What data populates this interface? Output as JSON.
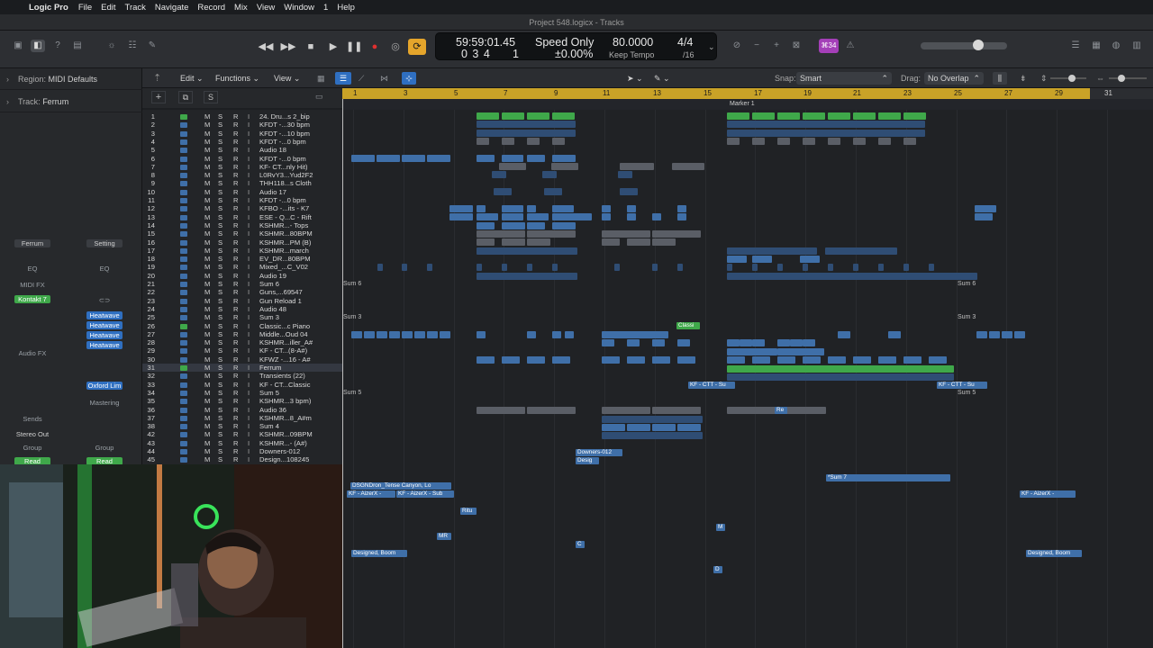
{
  "menubar": {
    "app_name": "Logic Pro",
    "items": [
      "File",
      "Edit",
      "Track",
      "Navigate",
      "Record",
      "Mix",
      "View",
      "Window",
      "1",
      "Help"
    ]
  },
  "window": {
    "title": "Project 548.logicx - Tracks"
  },
  "lcd": {
    "time": "59:59:01.45",
    "bars": "0  3  4",
    "bars_sub": "1",
    "mode": "Speed Only",
    "mode_val": "±0.00%",
    "tempo": "80.0000",
    "tempo_label": "Keep Tempo",
    "sig": "4/4",
    "div": "/16"
  },
  "toolbar": {
    "badge": "⌘34"
  },
  "inspector": {
    "region_label": "Region:",
    "region_value": "MIDI Defaults",
    "track_label": "Track:",
    "track_value": "Ferrum",
    "strip1": {
      "name": "Ferrum",
      "eq": "EQ",
      "midifx": "MIDI FX",
      "instrument": "Kontakt 7",
      "audiofx": "Audio FX",
      "sends": "Sends",
      "output": "Stereo Out",
      "group": "Group",
      "auto": "Read"
    },
    "strip2": {
      "name": "Setting",
      "eq": "EQ",
      "fx": [
        "Heatwave",
        "Heatwave",
        "Heatwave",
        "Heatwave"
      ],
      "oxford": "Oxford Lim",
      "mastering": "Mastering",
      "group": "Group",
      "auto": "Read"
    }
  },
  "editbar": {
    "edit": "Edit",
    "functions": "Functions",
    "view": "View",
    "snap_label": "Snap:",
    "snap_value": "Smart",
    "drag_label": "Drag:",
    "drag_value": "No Overlap"
  },
  "ruler": {
    "ticks": [
      "1",
      "3",
      "5",
      "7",
      "9",
      "11",
      "13",
      "15",
      "17",
      "19",
      "21",
      "23",
      "25",
      "27",
      "29",
      "31"
    ],
    "marker": "Marker 1"
  },
  "tracks": [
    {
      "n": "1",
      "name": "24. Dru...s 2_bip",
      "color": "#3fa84a"
    },
    {
      "n": "2",
      "name": "KFDT -...30 bpm",
      "color": "#3f6fa8"
    },
    {
      "n": "3",
      "name": "KFDT -...10 bpm",
      "color": "#3f6fa8"
    },
    {
      "n": "4",
      "name": "KFDT -...0 bpm",
      "color": "#3f6fa8"
    },
    {
      "n": "5",
      "name": "Audio 18",
      "color": "#3f6fa8"
    },
    {
      "n": "6",
      "name": "KFDT -...0 bpm",
      "color": "#3f6fa8"
    },
    {
      "n": "7",
      "name": "KF- CT...nly Hit)",
      "color": "#3f6fa8"
    },
    {
      "n": "8",
      "name": "L0RvY3...Yud2F2",
      "color": "#3f6fa8"
    },
    {
      "n": "9",
      "name": "THH118...s Cloth",
      "color": "#3f6fa8"
    },
    {
      "n": "10",
      "name": "Audio 17",
      "color": "#3f6fa8"
    },
    {
      "n": "11",
      "name": "KFDT -...0 bpm",
      "color": "#3f6fa8"
    },
    {
      "n": "12",
      "name": "KFBO -...its - K7",
      "color": "#3f6fa8"
    },
    {
      "n": "13",
      "name": "ESE - Q...C - Rift",
      "color": "#3f6fa8"
    },
    {
      "n": "14",
      "name": "KSHMR...- Tops",
      "color": "#3f6fa8"
    },
    {
      "n": "15",
      "name": "KSHMR...80BPM",
      "color": "#3f6fa8"
    },
    {
      "n": "16",
      "name": "KSHMR...PM (B)",
      "color": "#3f6fa8"
    },
    {
      "n": "17",
      "name": "KSHMR...march",
      "color": "#3f6fa8"
    },
    {
      "n": "18",
      "name": "EV_DR...80BPM",
      "color": "#3f6fa8"
    },
    {
      "n": "19",
      "name": "Mixed_...C_V02",
      "color": "#3f6fa8"
    },
    {
      "n": "20",
      "name": "Audio 19",
      "color": "#3f6fa8"
    },
    {
      "n": "21",
      "name": "Sum 6",
      "color": "#3f6fa8"
    },
    {
      "n": "22",
      "name": "Guns,...69547",
      "color": "#3f6fa8"
    },
    {
      "n": "23",
      "name": "Gun Reload 1",
      "color": "#3f6fa8"
    },
    {
      "n": "24",
      "name": "Audio 48",
      "color": "#3f6fa8"
    },
    {
      "n": "25",
      "name": "Sum 3",
      "color": "#3f6fa8"
    },
    {
      "n": "26",
      "name": "Classic...c Piano",
      "color": "#3fa84a"
    },
    {
      "n": "27",
      "name": "Middle...Oud 04",
      "color": "#3f6fa8"
    },
    {
      "n": "28",
      "name": "KSHMR...iller_A#",
      "color": "#3f6fa8"
    },
    {
      "n": "29",
      "name": "KF - CT...(8-A#)",
      "color": "#3f6fa8"
    },
    {
      "n": "30",
      "name": "KFWZ -...16 - A#",
      "color": "#3f6fa8"
    },
    {
      "n": "31",
      "name": "Ferrum",
      "color": "#3fa84a"
    },
    {
      "n": "32",
      "name": "Transients (22)",
      "color": "#3f6fa8"
    },
    {
      "n": "33",
      "name": "KF - CT...Classic",
      "color": "#3f6fa8"
    },
    {
      "n": "34",
      "name": "Sum 5",
      "color": "#3f6fa8"
    },
    {
      "n": "35",
      "name": "KSHMR...3 bpm)",
      "color": "#3f6fa8"
    },
    {
      "n": "36",
      "name": "Audio 36",
      "color": "#3f6fa8"
    },
    {
      "n": "37",
      "name": "KSHMR...8_A#m",
      "color": "#3f6fa8"
    },
    {
      "n": "38",
      "name": "Sum 4",
      "color": "#3f6fa8"
    },
    {
      "n": "42",
      "name": "KSHMR...09BPM",
      "color": "#3f6fa8"
    },
    {
      "n": "43",
      "name": "KSHMR...- (A#)",
      "color": "#3f6fa8"
    },
    {
      "n": "44",
      "name": "Downers-012",
      "color": "#3f6fa8"
    },
    {
      "n": "45",
      "name": "Design...108245",
      "color": "#3f6fa8"
    }
  ],
  "msri": {
    "m": "M",
    "s": "S",
    "r": "R",
    "i": "I"
  },
  "arrange_labels": {
    "sum6": "Sum 6",
    "sum3": "Sum 3",
    "sum5": "Sum 5",
    "classic": "Classi",
    "kfctt_su": "KF - CTT - Su",
    "sum7": "*Sum 7",
    "dsgn": "DSGNDron_Tense Canyon, Lo",
    "aizer1": "KF - AizerX -",
    "aizer2": "KF - AizerX - Sub",
    "aizer3": "KF - AizerX -",
    "designed1": "Designed, Boom",
    "designed2": "Designed, Boom",
    "downers": "Downers-012",
    "desig": "Desig",
    "ritu": "Ritu",
    "mr": "MR",
    "c": "C",
    "d": "D",
    "m": "M",
    "re": "Re"
  }
}
